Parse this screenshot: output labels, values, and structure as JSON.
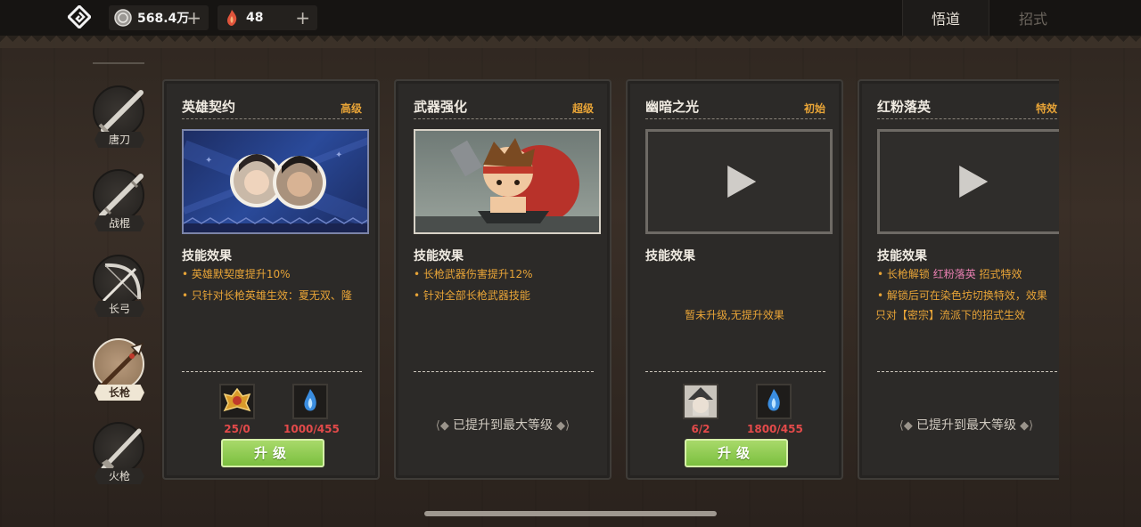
{
  "currency": [
    {
      "icon": "silver-coin-icon",
      "value": "568.4万"
    },
    {
      "icon": "flame-gem-icon",
      "value": "48"
    }
  ],
  "tabs": [
    {
      "label": "悟道",
      "active": true
    },
    {
      "label": "招式",
      "active": false
    }
  ],
  "nav": [
    {
      "label": "唐刀",
      "icon": "tang-sword-icon",
      "active": false
    },
    {
      "label": "战棍",
      "icon": "war-staff-icon",
      "active": false
    },
    {
      "label": "长弓",
      "icon": "longbow-icon",
      "active": false
    },
    {
      "label": "长枪",
      "icon": "spear-icon",
      "active": true
    },
    {
      "label": "火枪",
      "icon": "musket-icon",
      "active": false
    }
  ],
  "effect_label": "技能效果",
  "upgrade_label": "升级",
  "maxed_label": "已提升到最大等级",
  "cards": [
    {
      "title": "英雄契约",
      "grade": "高级",
      "media": "hero-portraits-image",
      "effects": [
        "• 英雄默契度提升10%",
        "• 只针对长枪英雄生效：夏无双、隆"
      ],
      "costs": [
        {
          "icon": "gold-emblem-icon",
          "value": "25/0"
        },
        {
          "icon": "blue-flame-icon",
          "value": "1000/455"
        }
      ],
      "state": "upgrade"
    },
    {
      "title": "武器强化",
      "grade": "超级",
      "media": "blacksmith-hero-image",
      "effects": [
        "• 长枪武器伤害提升12%",
        "• 针对全部长枪武器技能"
      ],
      "costs": [],
      "state": "maxed"
    },
    {
      "title": "幽暗之光",
      "grade": "初始",
      "media": "video-placeholder",
      "effects": [],
      "empty_text": "暂未升级,无提升效果",
      "costs": [
        {
          "icon": "witch-hero-icon",
          "value": "6/2"
        },
        {
          "icon": "blue-flame-icon",
          "value": "1800/455"
        }
      ],
      "state": "upgrade"
    },
    {
      "title": "红粉落英",
      "grade": "特效",
      "media": "video-placeholder",
      "effects": [
        {
          "pre": "• 长枪解锁 ",
          "hl": "红粉落英",
          "post": " 招式特效"
        },
        "• 解锁后可在染色坊切换特效，效果",
        "只对【密宗】流派下的招式生效"
      ],
      "costs": [],
      "state": "maxed"
    }
  ],
  "colors": {
    "accent_orange": "#e8a437",
    "cost_red": "#e34a4a",
    "upgrade_green": "#7bbf3f",
    "highlight_pink": "#e87fb0"
  }
}
